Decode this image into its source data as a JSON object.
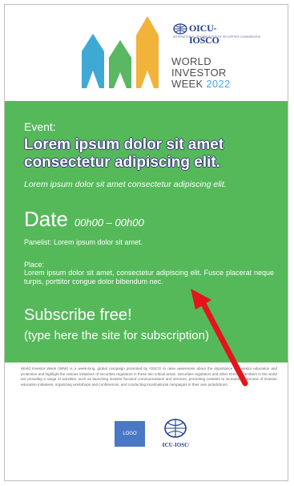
{
  "header": {
    "org_name": "OICU-IOSCO",
    "org_subtitle": "INTERNATIONAL ORGANIZATION OF SECURITIES COMMISSIONS",
    "campaign_line1": "WORLD",
    "campaign_line2": "INVESTOR",
    "campaign_line3": "WEEK",
    "campaign_year": "2022"
  },
  "event": {
    "label": "Event:",
    "title": "Lorem ipsum dolor sit amet consectetur adipiscing elit.",
    "subtitle": "Lorem ipsum dolor sit amet consectetur adipiscing elit.",
    "date_label": "Date",
    "time": "00h00 – 00h00",
    "panelist": "Panelist: Lorem ipsum dolor sit amet.",
    "place_label": "Place:",
    "place_text": "Lorem ipsum dolor sit amet, consectetur adipiscing elit. Fusce placerat neque turpis, porttitor congue dolor bibendum nec.",
    "subscribe": "Subscribe free!",
    "subscribe_sub": "(type here the site for subscription)"
  },
  "about": "World Investor Week (WIW) is a week-long, global campaign promoted by IOSCO to raise awareness about the importance of investor education and protection and highlight the various initiatives of securities regulators in these two critical areas. Securities regulators and other IOSCO members in the world are providing a range of activities, such as launching investor-focused communications and services, promoting contests to increase awareness of investor education initiatives, organizing workshops and conferences, and conducting local/national campaigns in their own jurisdictions.",
  "footer": {
    "logo_label": "LOGO",
    "org_name": "OICU-IOSCO"
  },
  "colors": {
    "panel_green": "#55b95a",
    "pencil_blue": "#3fa9d6",
    "pencil_green": "#59b861",
    "pencil_yellow": "#f2b33a",
    "arrow_red": "#e3151a",
    "logo_blue": "#4b78c4"
  }
}
